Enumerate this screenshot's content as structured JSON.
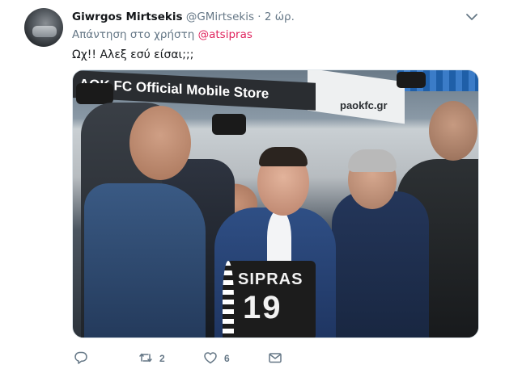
{
  "tweet": {
    "author_name": "Giwrgos Mirtsekis",
    "author_handle": "@GMirtsekis",
    "separator": "·",
    "timestamp": "2 ώρ.",
    "reply_prefix": "Απάντηση στο χρήστη",
    "reply_to": "@atsipras",
    "text": "Ωχ!! Αλεξ εσύ είσαι;;;"
  },
  "media": {
    "banner_text": "AOK FC Official Mobile Store",
    "site_text": "paokfc.gr",
    "jersey_name": "SIPRAS",
    "jersey_number": "19"
  },
  "actions": {
    "reply_count": "",
    "retweet_count": "2",
    "like_count": "6"
  },
  "icons": {
    "more": "chevron-down-icon",
    "reply": "reply-icon",
    "retweet": "retweet-icon",
    "like": "heart-icon",
    "message": "envelope-icon"
  },
  "colors": {
    "mention": "#e0245e",
    "secondary_text": "#657786",
    "primary_text": "#14171a"
  }
}
